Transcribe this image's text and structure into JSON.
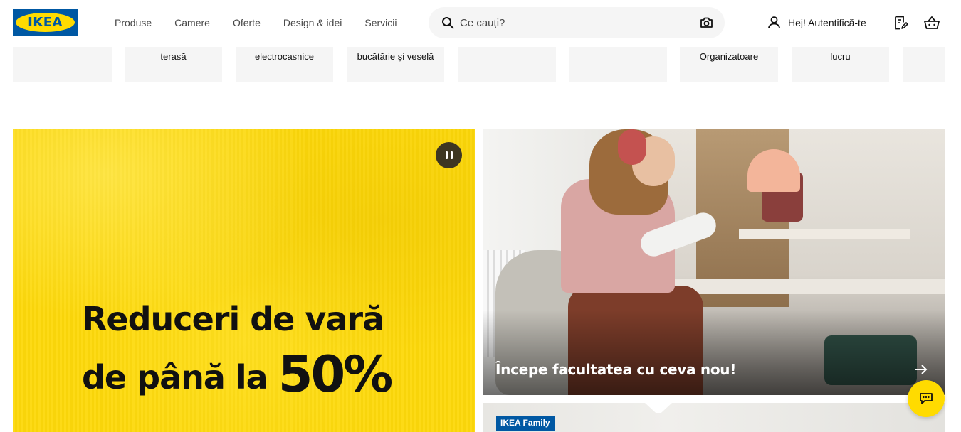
{
  "header": {
    "logo_text": "IKEA",
    "nav": [
      "Produse",
      "Camere",
      "Oferte",
      "Design & idei",
      "Servicii"
    ],
    "search": {
      "placeholder": "Ce cauți?"
    },
    "user_label": "Hej! Autentifică-te"
  },
  "categories": [
    "",
    "terasă",
    "electrocasnice",
    "bucătărie și veselă",
    "",
    "",
    "Organizatoare",
    "lucru",
    ""
  ],
  "hero_left": {
    "line1": "Reduceri de vară",
    "line2_prefix": "de până la",
    "line2_big": "50%"
  },
  "hero_right": {
    "caption": "Începe facultatea cu ceva nou!"
  },
  "card_bottom": {
    "badge": "IKEA Family"
  },
  "colors": {
    "ikea_blue": "#0058a3",
    "ikea_yellow": "#ffdb00",
    "promo_yellow": "#fdd80a"
  }
}
